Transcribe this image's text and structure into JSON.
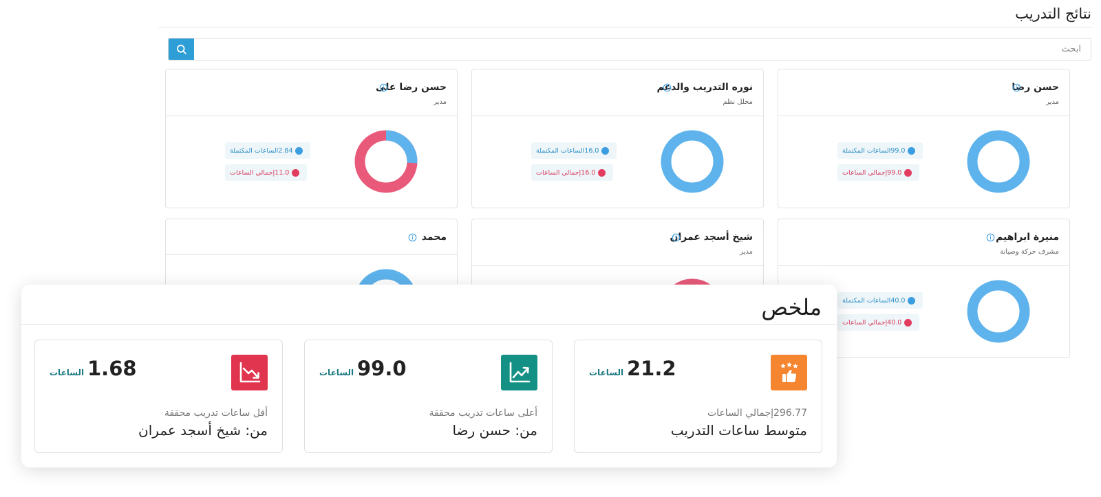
{
  "page": {
    "title": "نتائج التدريب",
    "search": {
      "placeholder": "ابحث",
      "icon": "search-icon"
    }
  },
  "colors": {
    "completed": "#3b9ee0",
    "total": "#e23c5f",
    "search_button": "#2d9fd6",
    "avg_icon": "#f5862f",
    "max_icon": "#149184",
    "min_icon": "#e0344f",
    "unit": "#1c7a83"
  },
  "cards": [
    {
      "name": "حسن رضا",
      "role": "مدير",
      "completed_label": "الساعات المكتملة",
      "completed": "99.0",
      "total_label": "إجمالي الساعات",
      "total": "99.0"
    },
    {
      "name": "نوره التدريب والدعم",
      "role": "محلل نظم",
      "completed_label": "الساعات المكتملة",
      "completed": "16.0",
      "total_label": "إجمالي الساعات",
      "total": "16.0"
    },
    {
      "name": "حسن رضا على",
      "role": "مدير",
      "completed_label": "الساعات المكتملة",
      "completed": "2.84",
      "total_label": "إجمالي الساعات",
      "total": "11.0"
    },
    {
      "name": "منيرة ابراهيم",
      "role": "مشرف حركة وصيانة",
      "completed_label": "الساعات المكتملة",
      "completed": "40.0",
      "total_label": "إجمالي الساعات",
      "total": "40.0"
    },
    {
      "name": "شيخ أسجد عمران",
      "role": "مدير"
    },
    {
      "name": "محمد",
      "role": ""
    }
  ],
  "summary": {
    "title": "ملخص",
    "stats": [
      {
        "icon": "thumbs-up-stars-icon",
        "value": "21.2",
        "unit": "الساعات",
        "sub": "296.77إجمالي الساعات",
        "main": "متوسط ساعات التدريب"
      },
      {
        "icon": "trend-up-icon",
        "value": "99.0",
        "unit": "الساعات",
        "sub": "أعلى ساعات تدريب محققة",
        "main": "من: حسن رضا"
      },
      {
        "icon": "trend-down-icon",
        "value": "1.68",
        "unit": "الساعات",
        "sub": "أقل ساعات تدريب محققة",
        "main": "من: شيخ أسجد عمران"
      }
    ]
  }
}
